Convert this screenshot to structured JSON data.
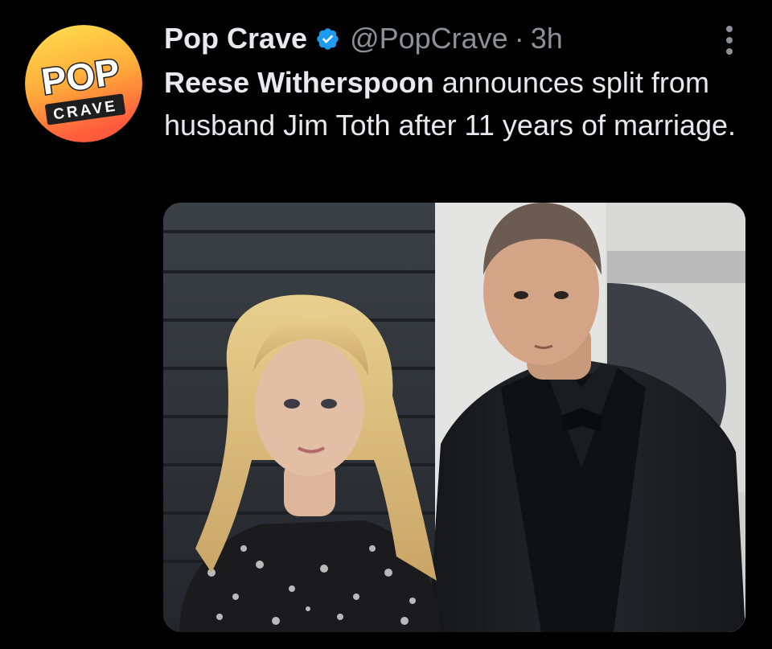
{
  "account": {
    "display_name": "Pop Crave",
    "handle": "@PopCrave",
    "separator": "·",
    "time_ago": "3h",
    "verified": true,
    "avatar_text_top": "POP",
    "avatar_text_bottom": "CRAVE"
  },
  "tweet": {
    "text_bold": "Reese Witherspoon",
    "text_rest": " announces split from husband Jim Toth after 11 years of marriage."
  },
  "colors": {
    "background": "#000000",
    "text_primary": "#e7e9ea",
    "text_secondary": "#8b9197",
    "verified_badge": "#1d9bf0",
    "avatar_gradient_top": "#ffd84d",
    "avatar_gradient_bottom": "#ff6a3d"
  },
  "icons": {
    "verified": "verified-badge-icon",
    "more": "more-options-icon"
  }
}
